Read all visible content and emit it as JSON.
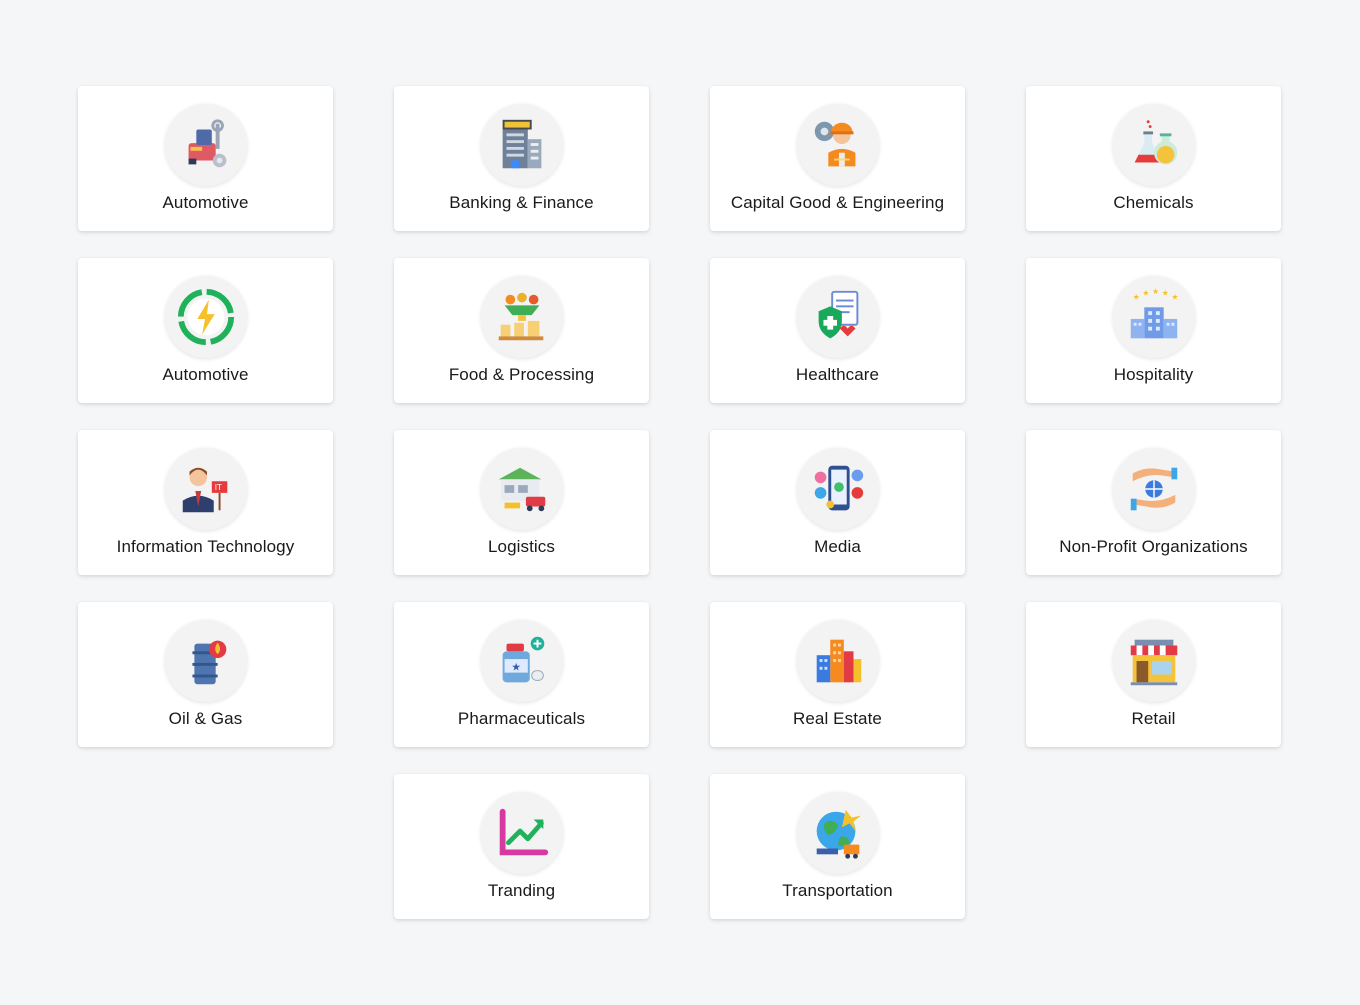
{
  "industries": [
    {
      "label": "Automotive",
      "icon": "car-wrench-icon"
    },
    {
      "label": "Banking & Finance",
      "icon": "bank-building-icon"
    },
    {
      "label": "Capital Good & Engineering",
      "icon": "engineer-gear-icon"
    },
    {
      "label": "Chemicals",
      "icon": "chemical-flask-icon"
    },
    {
      "label": "Automotive",
      "icon": "energy-bolt-icon"
    },
    {
      "label": "Food & Processing",
      "icon": "food-processing-icon"
    },
    {
      "label": "Healthcare",
      "icon": "health-shield-icon"
    },
    {
      "label": "Hospitality",
      "icon": "hotel-stars-icon"
    },
    {
      "label": "Information Technology",
      "icon": "it-businessman-icon"
    },
    {
      "label": "Logistics",
      "icon": "warehouse-truck-icon"
    },
    {
      "label": "Media",
      "icon": "social-phone-icon"
    },
    {
      "label": "Non-Profit Organizations",
      "icon": "hands-globe-icon"
    },
    {
      "label": "Oil & Gas",
      "icon": "oil-barrel-icon"
    },
    {
      "label": "Pharmaceuticals",
      "icon": "medicine-bottle-icon"
    },
    {
      "label": "Real Estate",
      "icon": "city-buildings-icon"
    },
    {
      "label": "Retail",
      "icon": "store-front-icon"
    },
    {
      "label": "Tranding",
      "icon": "trend-chart-icon"
    },
    {
      "label": "Transportation",
      "icon": "globe-transport-icon"
    }
  ],
  "colors": {
    "background": "#f5f6f8",
    "card": "#ffffff",
    "text": "#1a1a1a"
  }
}
